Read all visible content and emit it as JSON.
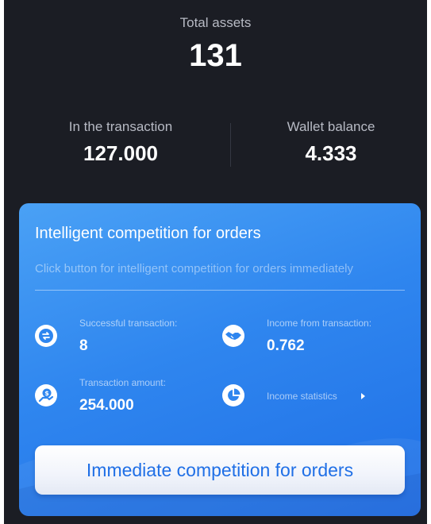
{
  "summary": {
    "total_assets_label": "Total assets",
    "total_assets_value": "131",
    "in_transaction_label": "In the transaction",
    "in_transaction_value": "127.000",
    "wallet_balance_label": "Wallet balance",
    "wallet_balance_value": "4.333"
  },
  "card": {
    "title": "Intelligent competition for orders",
    "hint": "Click button for intelligent competition for orders immediately",
    "metrics": [
      {
        "label": "Successful transaction:",
        "value": "8",
        "icon": "swap-icon"
      },
      {
        "label": "Income from transaction:",
        "value": "0.762",
        "icon": "handshake-icon"
      },
      {
        "label": "Transaction amount:",
        "value": "254.000",
        "icon": "money-hand-icon"
      },
      {
        "label": "Income statistics",
        "icon": "pie-chart-icon"
      }
    ],
    "button_label": "Immediate competition for orders"
  },
  "colors": {
    "background": "#1b1d24",
    "card_accent": "#2f86ef",
    "button_text": "#1f6fe6"
  }
}
